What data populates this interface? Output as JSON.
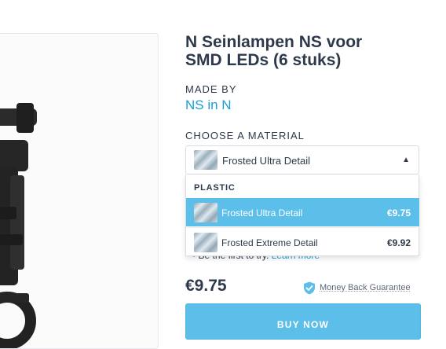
{
  "product": {
    "title_line1": "N Seinlampen NS voor",
    "title_line2": "SMD LEDs (6 stuks)",
    "made_by_label": "MADE BY",
    "maker": "NS in N"
  },
  "material": {
    "label": "CHOOSE A MATERIAL",
    "selected": "Frosted Ultra Detail",
    "group": "PLASTIC",
    "options": [
      {
        "name": "Frosted Ultra Detail",
        "price": "€9.75",
        "selected": true
      },
      {
        "name": "Frosted Extreme Detail",
        "price": "€9.92",
        "selected": false
      }
    ]
  },
  "review": {
    "text": "Be the first to try.",
    "link": "Learn more"
  },
  "purchase": {
    "price": "€9.75",
    "guarantee": "Money Back Guarantee",
    "buy_label": "BUY NOW"
  },
  "colors": {
    "accent": "#5bbfea",
    "link": "#1a9fd8",
    "text": "#2e3a4b"
  },
  "icons": [
    "shield-check-icon",
    "caret-up-icon",
    "material-swatch-icon"
  ]
}
